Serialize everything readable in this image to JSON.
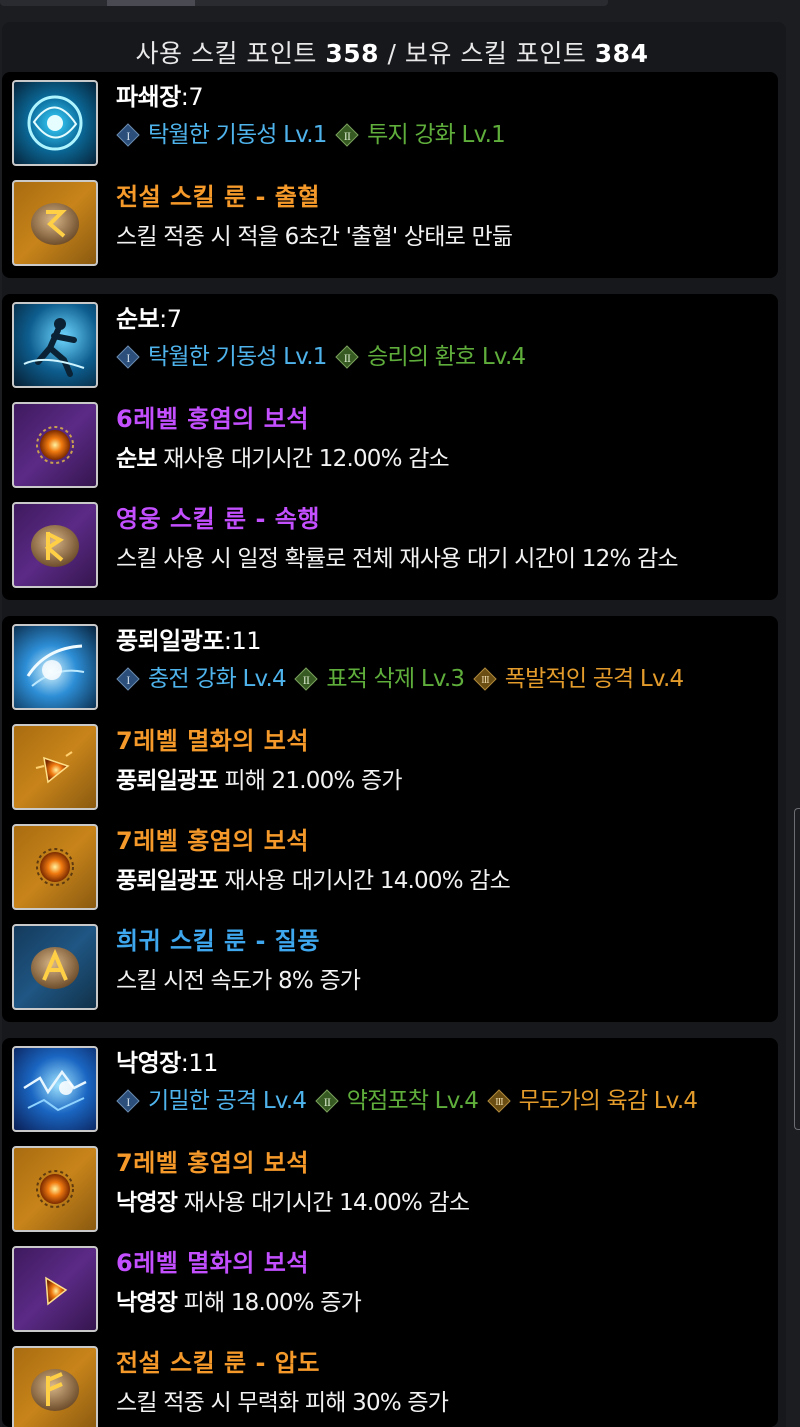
{
  "summary": {
    "used_label": "사용 스킬 포인트",
    "used_value": "358",
    "separator": "/",
    "owned_label": "보유 스킬 포인트",
    "owned_value": "384"
  },
  "colors": {
    "legend": "#f59a2a",
    "hero": "#c34fff",
    "rare": "#3ea7ee",
    "tripod_1": "#4fb3ec",
    "tripod_2": "#5fae3c",
    "tripod_3": "#e39c2b"
  },
  "skills": [
    {
      "name": "파쇄장",
      "level": ":7",
      "tripods": [
        {
          "tier": "I",
          "text": "탁월한 기동성 Lv.1"
        },
        {
          "tier": "II",
          "text": "투지 강화 Lv.1"
        }
      ],
      "items": [
        {
          "icon": "rune-icon",
          "title": "전설 스킬 룬 - 출혈",
          "desc": "스킬 적중 시 적을 6초간 '출혈' 상태로 만듦",
          "desc_bold": ""
        }
      ]
    },
    {
      "name": "순보",
      "level": ":7",
      "tripods": [
        {
          "tier": "I",
          "text": "탁월한 기동성 Lv.1"
        },
        {
          "tier": "II",
          "text": "승리의 환호 Lv.4"
        }
      ],
      "items": [
        {
          "icon": "gem-icon",
          "title": "6레벨 홍염의 보석",
          "desc_bold": "순보",
          "desc": "재사용 대기시간 12.00% 감소"
        },
        {
          "icon": "rune-icon",
          "title": "영웅 스킬 룬 - 속행",
          "desc_bold": "",
          "desc": "스킬 사용 시 일정 확률로 전체 재사용 대기 시간이 12% 감소"
        }
      ]
    },
    {
      "name": "풍뢰일광포",
      "level": ":11",
      "tripods": [
        {
          "tier": "I",
          "text": "충전 강화 Lv.4"
        },
        {
          "tier": "II",
          "text": "표적 삭제 Lv.3"
        },
        {
          "tier": "III",
          "text": "폭발적인 공격 Lv.4"
        }
      ],
      "items": [
        {
          "icon": "gem-icon",
          "title": "7레벨 멸화의 보석",
          "desc_bold": "풍뢰일광포",
          "desc": "피해 21.00% 증가"
        },
        {
          "icon": "gem-icon",
          "title": "7레벨 홍염의 보석",
          "desc_bold": "풍뢰일광포",
          "desc": "재사용 대기시간 14.00% 감소"
        },
        {
          "icon": "rune-icon",
          "title": "희귀 스킬 룬 - 질풍",
          "desc_bold": "",
          "desc": "스킬 시전 속도가 8% 증가"
        }
      ]
    },
    {
      "name": "낙영장",
      "level": ":11",
      "tripods": [
        {
          "tier": "I",
          "text": "기밀한 공격 Lv.4"
        },
        {
          "tier": "II",
          "text": "약점포착 Lv.4"
        },
        {
          "tier": "III",
          "text": "무도가의 육감 Lv.4"
        }
      ],
      "items": [
        {
          "icon": "gem-icon",
          "title": "7레벨 홍염의 보석",
          "desc_bold": "낙영장",
          "desc": "재사용 대기시간 14.00% 감소"
        },
        {
          "icon": "gem-icon",
          "title": "6레벨 멸화의 보석",
          "desc_bold": "낙영장",
          "desc": "피해 18.00% 증가"
        },
        {
          "icon": "rune-icon",
          "title": "전설 스킬 룬 - 압도",
          "desc_bold": "",
          "desc": "스킬 적중 시 무력화 피해 30% 증가"
        }
      ]
    }
  ]
}
